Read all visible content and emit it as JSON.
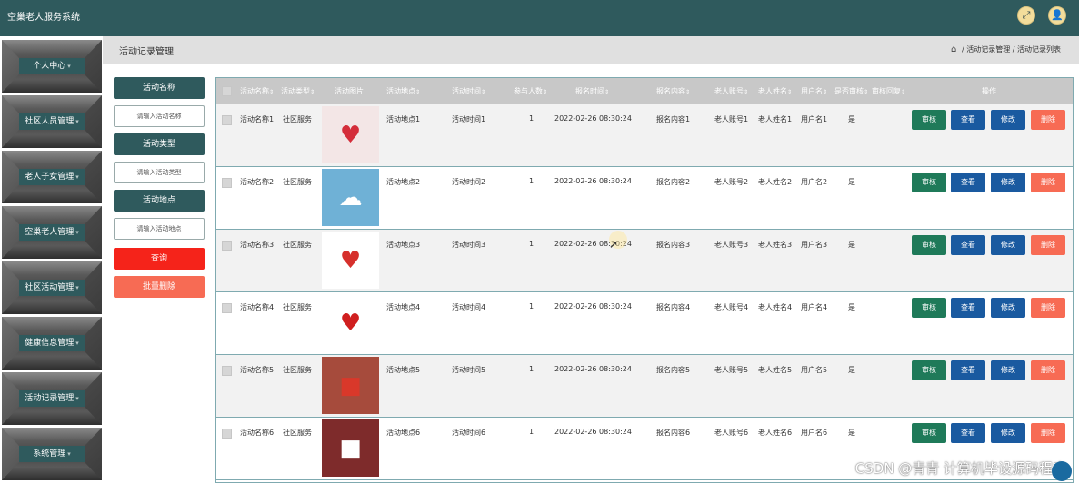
{
  "app": {
    "title": "空巢老人服务系统"
  },
  "header_icons": [
    {
      "icon": "fullscreen-icon",
      "glyph": "⤢"
    },
    {
      "icon": "user-icon",
      "glyph": "👤"
    }
  ],
  "sidebar": {
    "items": [
      {
        "label": "个人中心"
      },
      {
        "label": "社区人员管理"
      },
      {
        "label": "老人子女管理"
      },
      {
        "label": "空巢老人管理"
      },
      {
        "label": "社区活动管理"
      },
      {
        "label": "健康信息管理"
      },
      {
        "label": "活动记录管理"
      },
      {
        "label": "系统管理"
      }
    ]
  },
  "page": {
    "title": "活动记录管理",
    "breadcrumb": [
      "活动记录管理",
      "活动记录列表"
    ],
    "breadcrumb_sep": "/"
  },
  "search": {
    "fields": [
      {
        "label": "活动名称",
        "placeholder": "请输入活动名称"
      },
      {
        "label": "活动类型",
        "placeholder": "请输入活动类型"
      },
      {
        "label": "活动地点",
        "placeholder": "请输入活动地点"
      }
    ],
    "query_label": "查询",
    "batch_delete_label": "批量删除"
  },
  "table": {
    "columns": [
      "活动名称",
      "活动类型",
      "活动图片",
      "活动地点",
      "活动时间",
      "参与人数",
      "报名时间",
      "报名内容",
      "老人账号",
      "老人姓名",
      "用户名",
      "是否审核",
      "审核回复",
      "操作"
    ],
    "sort_mark": "⇕",
    "actions": {
      "audit": "审核",
      "view": "查看",
      "edit": "修改",
      "delete": "删除"
    },
    "rows": [
      {
        "name": "活动名称1",
        "type": "社区服务",
        "place": "活动地点1",
        "time": "活动时间1",
        "count": "1",
        "signup_time": "2022-02-26 08:30:24",
        "content": "报名内容1",
        "account": "老人账号1",
        "elder_name": "老人姓名1",
        "username": "用户名1",
        "audited": "是",
        "reply": ""
      },
      {
        "name": "活动名称2",
        "type": "社区服务",
        "place": "活动地点2",
        "time": "活动时间2",
        "count": "1",
        "signup_time": "2022-02-26 08:30:24",
        "content": "报名内容2",
        "account": "老人账号2",
        "elder_name": "老人姓名2",
        "username": "用户名2",
        "audited": "是",
        "reply": ""
      },
      {
        "name": "活动名称3",
        "type": "社区服务",
        "place": "活动地点3",
        "time": "活动时间3",
        "count": "1",
        "signup_time": "2022-02-26 08:30:24",
        "content": "报名内容3",
        "account": "老人账号3",
        "elder_name": "老人姓名3",
        "username": "用户名3",
        "audited": "是",
        "reply": ""
      },
      {
        "name": "活动名称4",
        "type": "社区服务",
        "place": "活动地点4",
        "time": "活动时间4",
        "count": "1",
        "signup_time": "2022-02-26 08:30:24",
        "content": "报名内容4",
        "account": "老人账号4",
        "elder_name": "老人姓名4",
        "username": "用户名4",
        "audited": "是",
        "reply": ""
      },
      {
        "name": "活动名称5",
        "type": "社区服务",
        "place": "活动地点5",
        "time": "活动时间5",
        "count": "1",
        "signup_time": "2022-02-26 08:30:24",
        "content": "报名内容5",
        "account": "老人账号5",
        "elder_name": "老人姓名5",
        "username": "用户名5",
        "audited": "是",
        "reply": ""
      },
      {
        "name": "活动名称6",
        "type": "社区服务",
        "place": "活动地点6",
        "time": "活动时间6",
        "count": "1",
        "signup_time": "2022-02-26 08:30:24",
        "content": "报名内容6",
        "account": "老人账号6",
        "elder_name": "老人姓名6",
        "username": "用户名6",
        "audited": "是",
        "reply": ""
      }
    ],
    "images": [
      {
        "icon": "heart-hands-image",
        "bg": "#f3e6e6",
        "fg": "#d42d3a"
      },
      {
        "icon": "cloud-sky-image",
        "bg": "#6fb1d6",
        "fg": "#ffffff"
      },
      {
        "icon": "heart-mosaic-image",
        "bg": "#ffffff",
        "fg": "#d6302c"
      },
      {
        "icon": "hands-heart-image",
        "bg": "#ffffff",
        "fg": "#d01f1f"
      },
      {
        "icon": "volunteers-photo-image",
        "bg": "#a64b3c",
        "fg": "#d9382a"
      },
      {
        "icon": "calligraphy-photo-image",
        "bg": "#7e2b2b",
        "fg": "#ffffff"
      }
    ]
  },
  "watermark": "CSDN @青青  计算机毕设源码程序",
  "colors": {
    "header": "#2f5a5d",
    "query": "#f5231a",
    "batch_delete": "#f76b54",
    "audit": "#1f7a59",
    "view_edit": "#1a5aa0",
    "delete": "#f76b54"
  }
}
